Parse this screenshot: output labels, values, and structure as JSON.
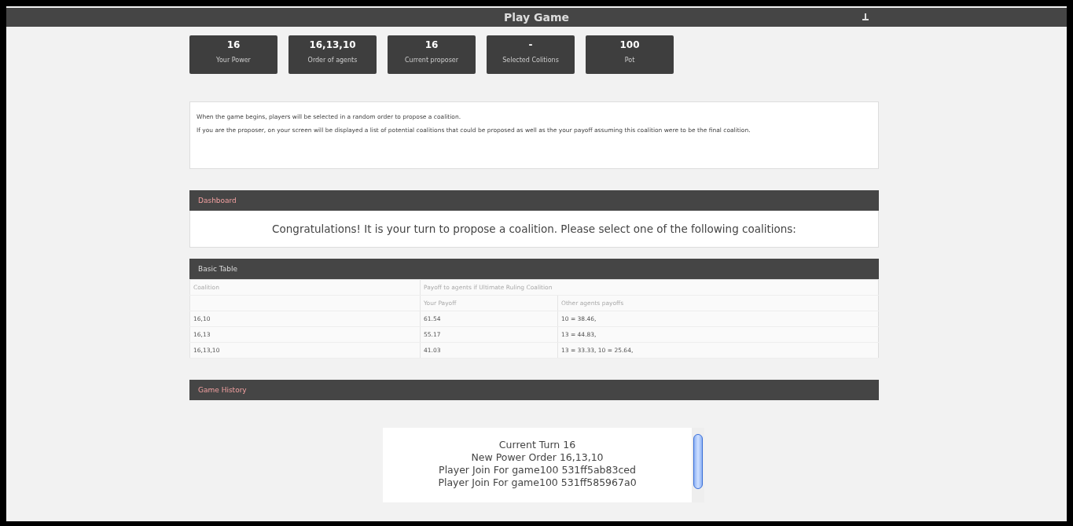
{
  "header": {
    "title": "Play Game"
  },
  "stats": [
    {
      "value": "16",
      "label": "Your Power"
    },
    {
      "value": "16,13,10",
      "label": "Order of agents"
    },
    {
      "value": "16",
      "label": "Current proposer"
    },
    {
      "value": "-",
      "label": "Selected Colitions"
    },
    {
      "value": "100",
      "label": "Pot"
    }
  ],
  "info": [
    "When the game begins, players will be selected in a random order to propose a coalition.",
    "If you are the proposer, on your screen will be displayed a list of potential coalitions that could be proposed as well as the your payoff assuming this coalition were to be the final coalition."
  ],
  "dashboard": {
    "title": "Dashboard",
    "message": "Congratulations! It is your turn to propose a coalition. Please select one of the following coalitions:"
  },
  "table": {
    "title": "Basic Table",
    "group_header": "Payoff to agents if Ultimate Ruling Coalition",
    "columns": [
      "Coalition",
      "Your Payoff",
      "Other agents payoffs"
    ],
    "rows": [
      [
        "16,10",
        "61.54",
        "10 = 38.46,"
      ],
      [
        "16,13",
        "55.17",
        "13 = 44.83,"
      ],
      [
        "16,13,10",
        "41.03",
        "13 = 33.33, 10 = 25.64,"
      ]
    ]
  },
  "history": {
    "title": "Game History",
    "lines": [
      "Current Turn 16",
      "New Power Order 16,13,10",
      "Player Join For game100 531ff5ab83ced",
      "Player Join For game100 531ff585967a0"
    ]
  }
}
